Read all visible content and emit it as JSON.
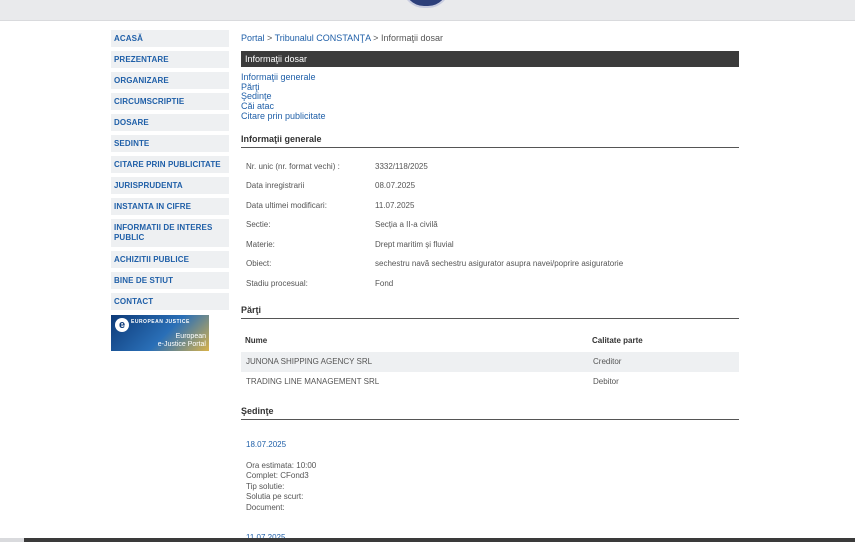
{
  "sidebar": {
    "items": [
      {
        "label": "ACASĂ"
      },
      {
        "label": "PREZENTARE"
      },
      {
        "label": "ORGANIZARE"
      },
      {
        "label": "CIRCUMSCRIPTIE"
      },
      {
        "label": "DOSARE"
      },
      {
        "label": "SEDINTE"
      },
      {
        "label": "CITARE PRIN PUBLICITATE"
      },
      {
        "label": "JURISPRUDENTA"
      },
      {
        "label": "INSTANTA IN CIFRE"
      },
      {
        "label": "INFORMATII DE INTERES PUBLIC"
      },
      {
        "label": "ACHIZITII PUBLICE"
      },
      {
        "label": "BINE DE STIUT"
      },
      {
        "label": "CONTACT"
      }
    ],
    "banner": {
      "small_text": "EUROPEAN JUSTICE",
      "caption_line1": "European",
      "caption_line2": "e-Justice Portal"
    }
  },
  "breadcrumb": {
    "portal": "Portal",
    "court": "Tribunalul CONSTANŢA",
    "current": "Informaţii dosar"
  },
  "title": "Informaţii dosar",
  "anchors": [
    "Informaţii generale",
    "Părţi",
    "Şedinţe",
    "Căi atac",
    "Citare prin publicitate"
  ],
  "general": {
    "section_title": "Informaţii generale",
    "rows": [
      {
        "label": "Nr. unic (nr. format vechi) :",
        "value": "3332/118/2025"
      },
      {
        "label": "Data inregistrarii",
        "value": "08.07.2025"
      },
      {
        "label": "Data ultimei modificari:",
        "value": "11.07.2025"
      },
      {
        "label": "Sectie:",
        "value": "Secția a II-a civilă"
      },
      {
        "label": "Materie:",
        "value": "Drept maritim și fluvial"
      },
      {
        "label": "Obiect:",
        "value": "sechestru navă sechestru asigurator asupra navei/poprire asiguratorie"
      },
      {
        "label": "Stadiu procesual:",
        "value": "Fond"
      }
    ]
  },
  "parti": {
    "section_title": "Părţi",
    "header_name": "Nume",
    "header_calitate": "Calitate parte",
    "rows": [
      {
        "name": "JUNONA SHIPPING AGENCY SRL",
        "calitate": "Creditor"
      },
      {
        "name": "TRADING LINE MANAGEMENT SRL",
        "calitate": "Debitor"
      }
    ]
  },
  "sedinte": {
    "section_title": "Şedinţe",
    "sessions": [
      {
        "date": "18.07.2025",
        "ora": "Ora estimata: 10:00",
        "complet": "Complet: CFond3",
        "tip": "Tip solutie:",
        "solutia": "Solutia pe scurt:",
        "document": "Document:"
      },
      {
        "date": "11.07.2025"
      }
    ]
  }
}
